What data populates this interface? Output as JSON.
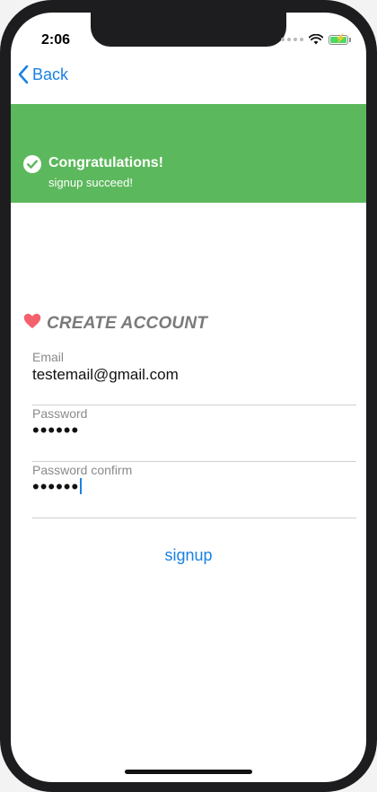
{
  "status_bar": {
    "time": "2:06",
    "icons": [
      "signal-dots-icon",
      "wifi-icon",
      "battery-charging-icon"
    ],
    "battery_color": "#4cd964"
  },
  "nav": {
    "back_label": "Back",
    "back_color": "#1a82e2"
  },
  "banner": {
    "icon": "check-circle-icon",
    "title": "Congratulations!",
    "message": "signup succeed!",
    "background": "#5cb85c"
  },
  "form": {
    "heading_icon": "heart-icon",
    "heading": "CREATE ACCOUNT",
    "heart_color": "#f4606c",
    "fields": [
      {
        "label": "Email",
        "value": "testemail@gmail.com"
      },
      {
        "label": "Password",
        "value": "••••••"
      },
      {
        "label": "Password confirm",
        "value": "••••••"
      }
    ],
    "submit_label": "signup"
  }
}
